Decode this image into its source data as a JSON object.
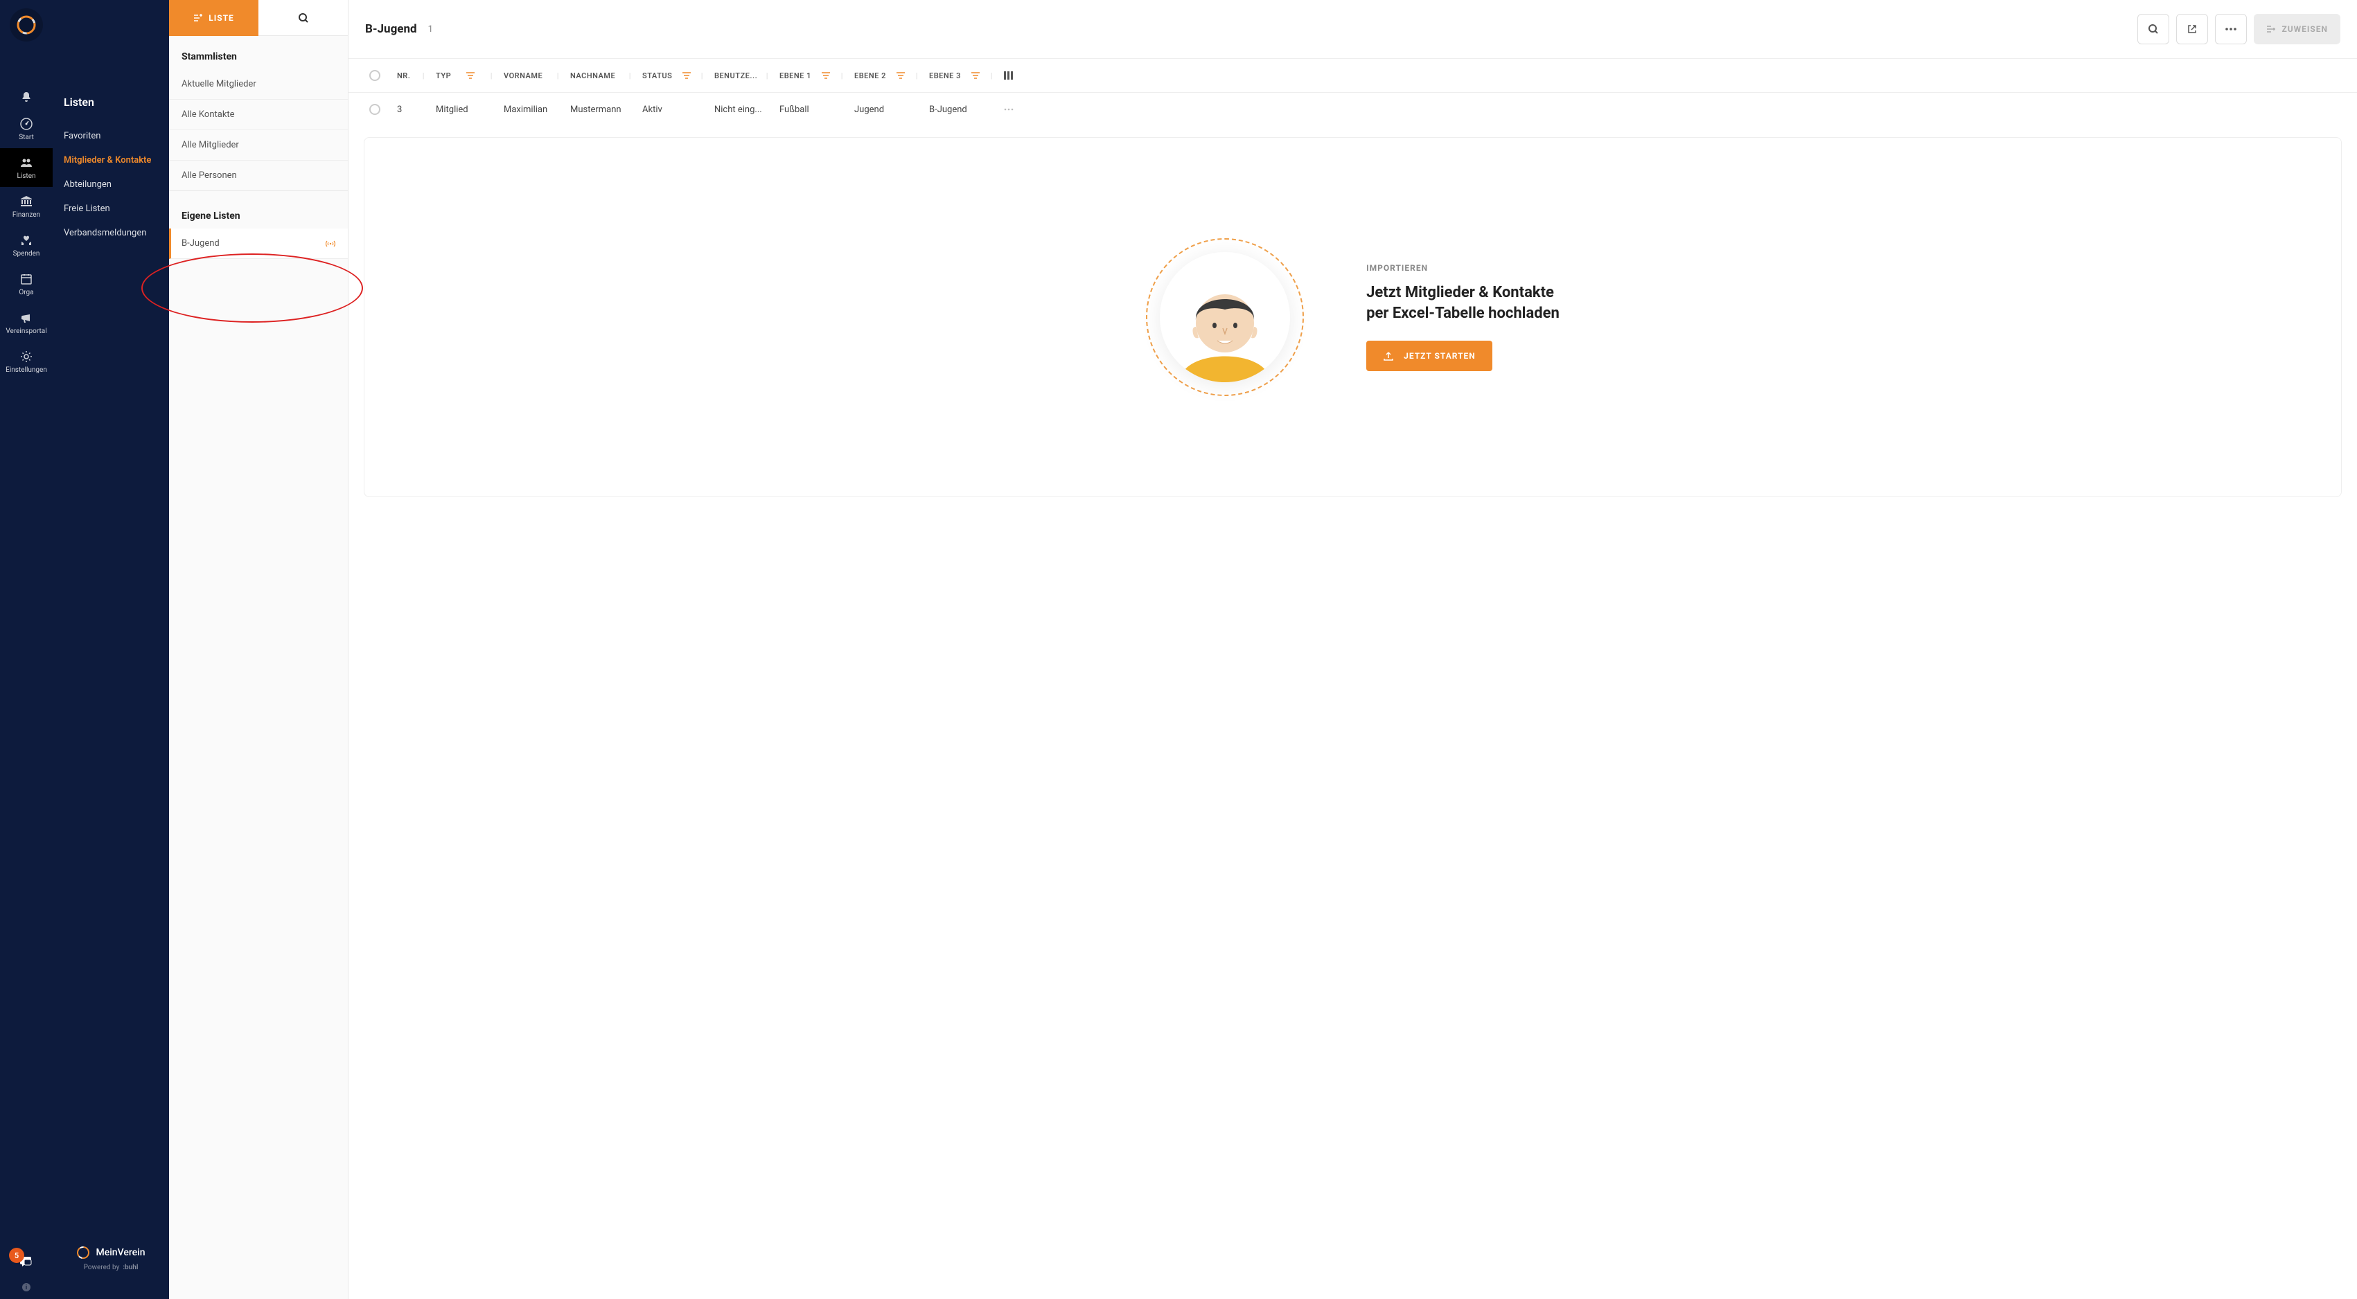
{
  "rail": {
    "items": [
      {
        "id": "bell",
        "label": ""
      },
      {
        "id": "start",
        "label": "Start"
      },
      {
        "id": "listen",
        "label": "Listen"
      },
      {
        "id": "finanzen",
        "label": "Finanzen"
      },
      {
        "id": "spenden",
        "label": "Spenden"
      },
      {
        "id": "orga",
        "label": "Orga"
      },
      {
        "id": "vereinsportal",
        "label": "Vereinsportal"
      },
      {
        "id": "einstellungen",
        "label": "Einstellungen"
      }
    ],
    "badge": "5"
  },
  "side2": {
    "title": "Listen",
    "items": [
      {
        "label": "Favoriten"
      },
      {
        "label": "Mitglieder & Kontakte"
      },
      {
        "label": "Abteilungen"
      },
      {
        "label": "Freie Listen"
      },
      {
        "label": "Verbandsmeldungen"
      }
    ],
    "brand": "MeinVerein",
    "powered": "Powered by",
    "powered_brand": ":buhl"
  },
  "lists": {
    "tab_label": "LISTE",
    "group1_title": "Stammlisten",
    "group1": [
      {
        "label": "Aktuelle Mitglieder"
      },
      {
        "label": "Alle Kontakte"
      },
      {
        "label": "Alle Mitglieder"
      },
      {
        "label": "Alle Personen"
      }
    ],
    "group2_title": "Eigene Listen",
    "group2": [
      {
        "label": "B-Jugend"
      }
    ]
  },
  "main": {
    "title": "B-Jugend",
    "count": "1",
    "assign": "ZUWEISEN",
    "columns": {
      "nr": "NR.",
      "typ": "TYP",
      "vorname": "VORNAME",
      "nachname": "NACHNAME",
      "status": "STATUS",
      "benutzer": "BENUTZE...",
      "e1": "EBENE 1",
      "e2": "EBENE 2",
      "e3": "EBENE 3"
    },
    "rows": [
      {
        "nr": "3",
        "typ": "Mitglied",
        "vorname": "Maximilian",
        "nachname": "Mustermann",
        "status": "Aktiv",
        "benutzer": "Nicht eing...",
        "e1": "Fußball",
        "e2": "Jugend",
        "e3": "B-Jugend"
      }
    ]
  },
  "import": {
    "kicker": "IMPORTIEREN",
    "headline1": "Jetzt Mitglieder & Kontakte",
    "headline2": "per Excel-Tabelle hochladen",
    "button": "JETZT STARTEN"
  }
}
